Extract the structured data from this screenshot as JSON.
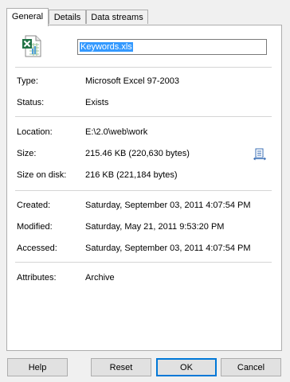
{
  "tabs": [
    {
      "label": "General",
      "active": true
    },
    {
      "label": "Details",
      "active": false
    },
    {
      "label": "Data streams",
      "active": false
    }
  ],
  "icons": {
    "file": "excel-file-icon",
    "size": "size-info-icon"
  },
  "general": {
    "file_name": "Keywords.xls",
    "type_label": "Type:",
    "type_value": "Microsoft Excel 97-2003",
    "status_label": "Status:",
    "status_value": "Exists",
    "location_label": "Location:",
    "location_value": "E:\\2.0\\web\\work",
    "size_label": "Size:",
    "size_value": "215.46 KB (220,630 bytes)",
    "size_on_disk_label": "Size on disk:",
    "size_on_disk_value": "216 KB (221,184 bytes)",
    "created_label": "Created:",
    "created_value": "Saturday, September 03, 2011 4:07:54 PM",
    "modified_label": "Modified:",
    "modified_value": "Saturday, May 21, 2011 9:53:20 PM",
    "accessed_label": "Accessed:",
    "accessed_value": "Saturday, September 03, 2011 4:07:54 PM",
    "attributes_label": "Attributes:",
    "attributes_value": "Archive"
  },
  "buttons": {
    "help": "Help",
    "reset": "Reset",
    "ok": "OK",
    "cancel": "Cancel"
  },
  "colors": {
    "selection": "#3399ff",
    "default_button_border": "#0078d7",
    "excel_green": "#217346"
  }
}
